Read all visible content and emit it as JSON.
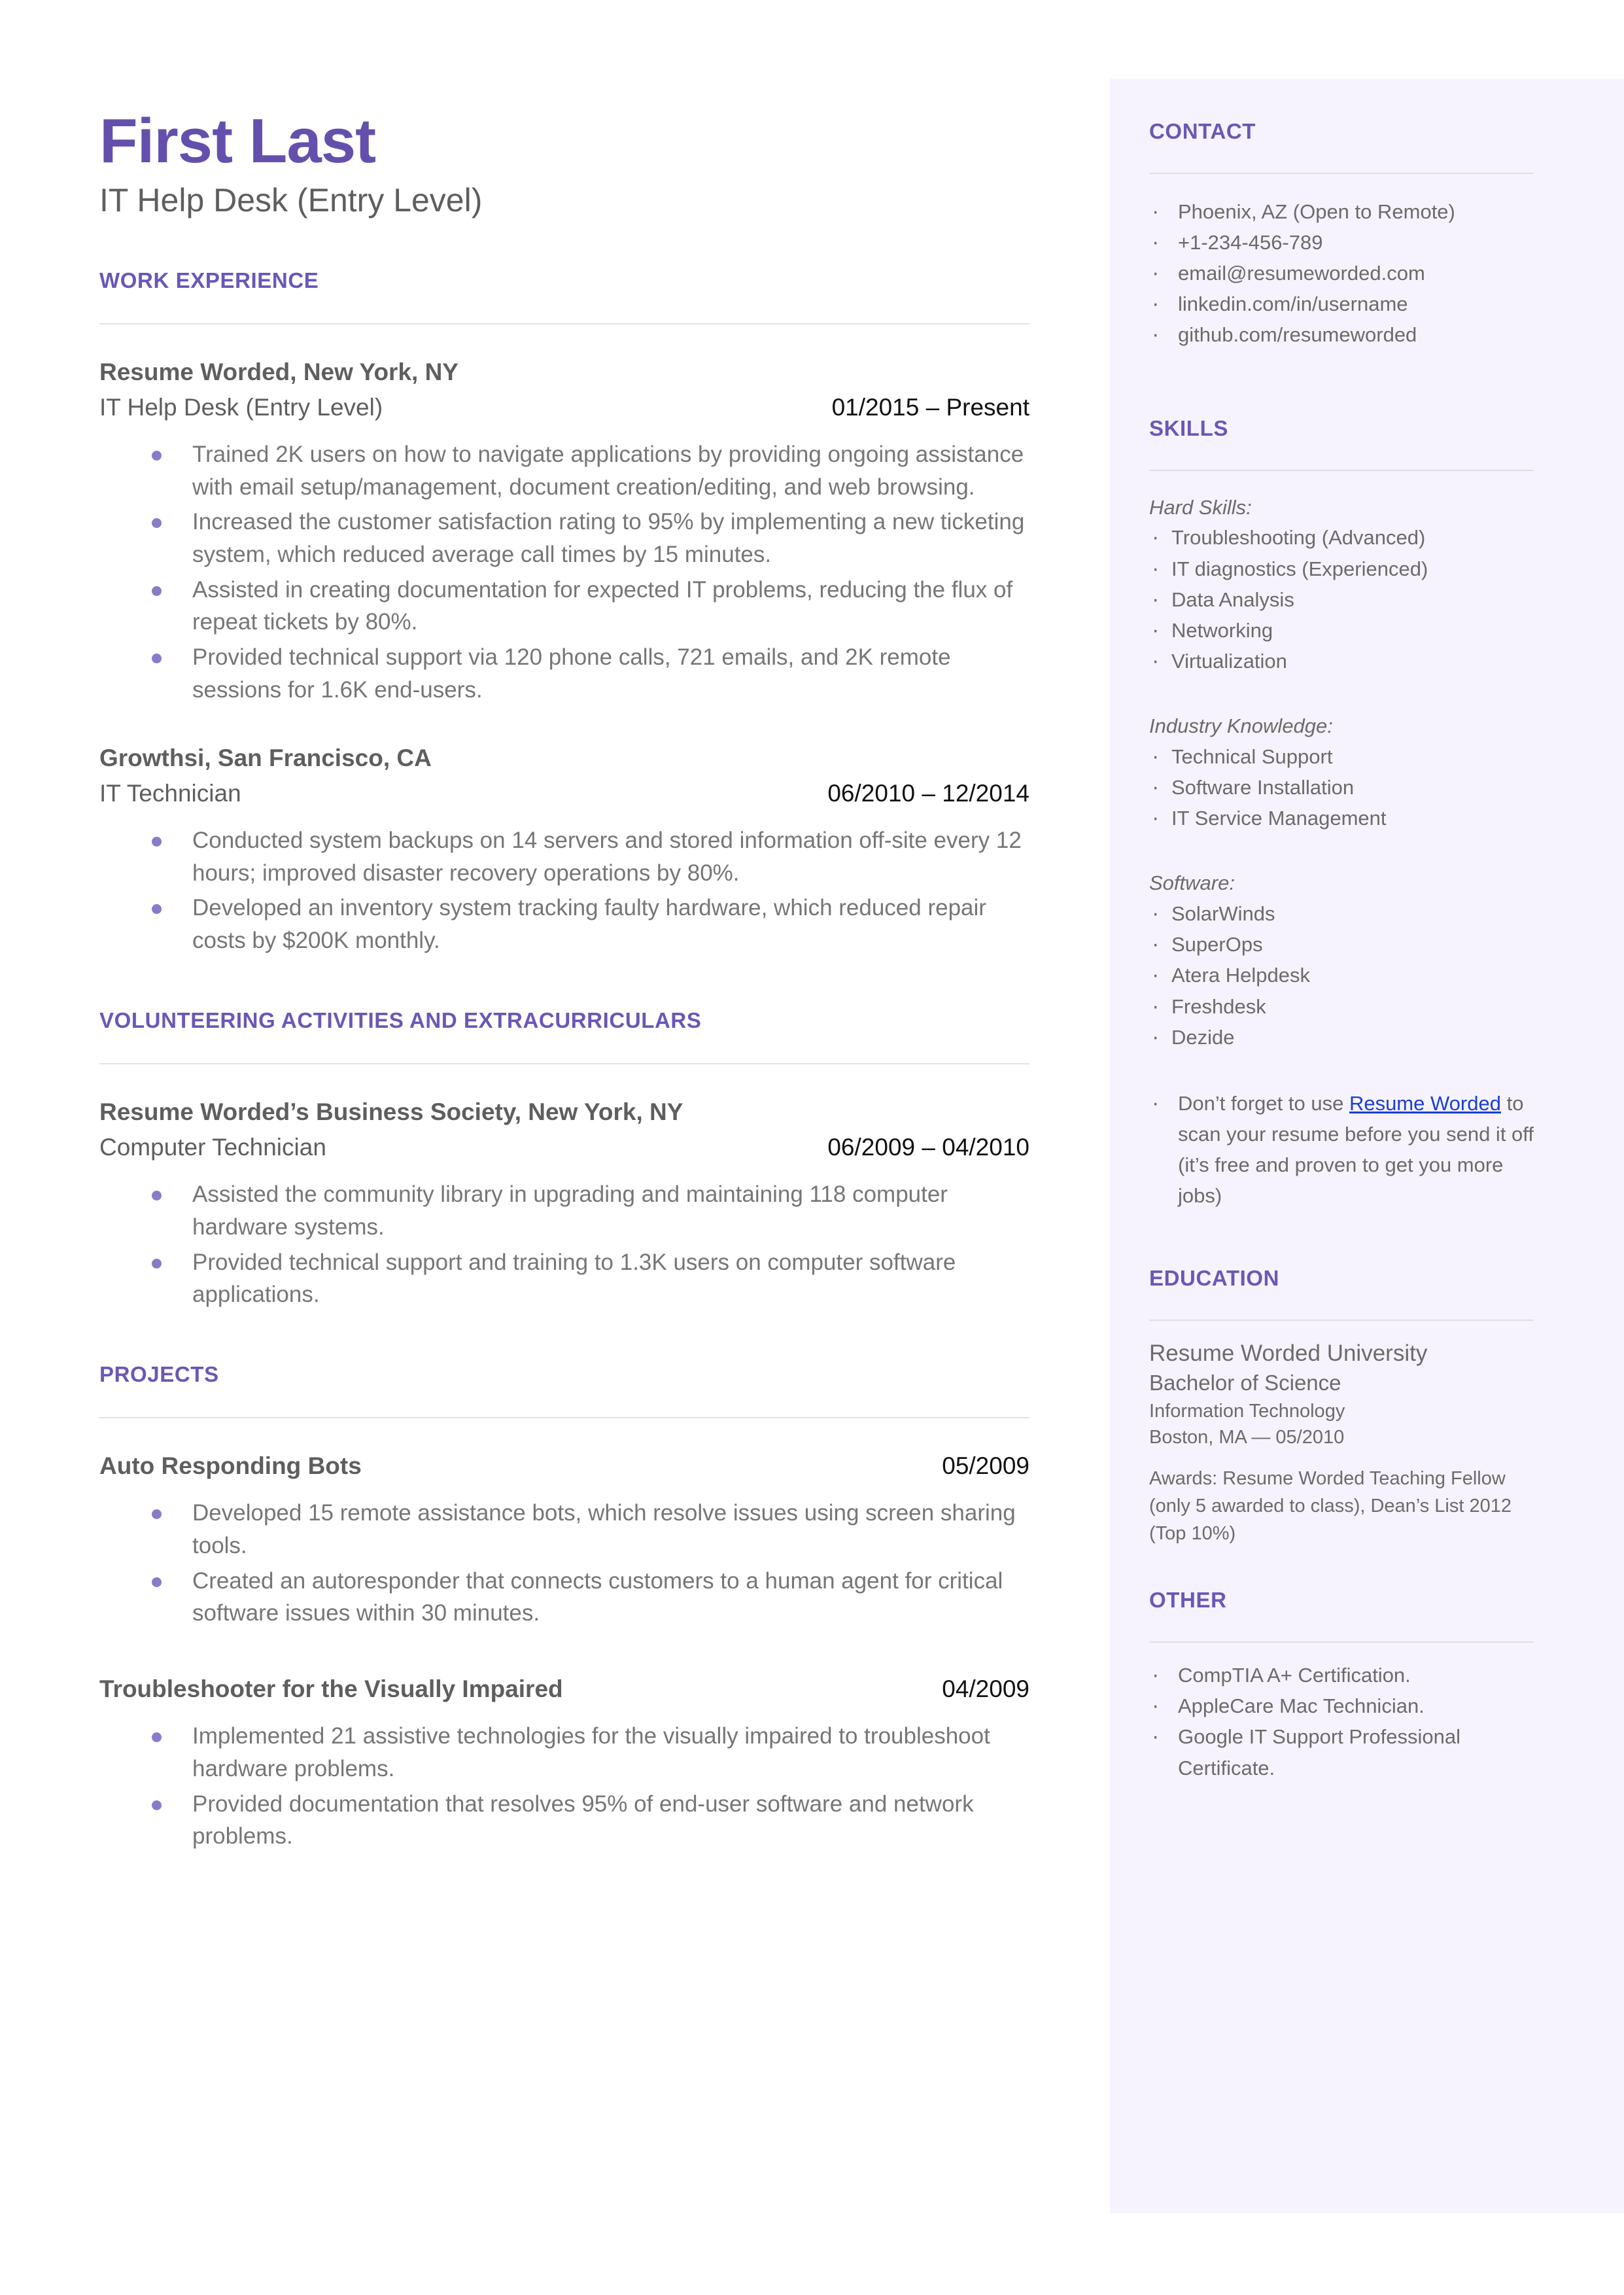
{
  "theme": {
    "accent_purple": "#6450ac",
    "heading_purple": "#6b57b5",
    "bullet_purple": "#8b7bc7",
    "sidebar_bg": "#f6f3fe",
    "body_gray": "#767676",
    "link_blue": "#1a3fd4"
  },
  "header": {
    "name": "First Last",
    "headline": "IT Help Desk (Entry Level)"
  },
  "main": {
    "sections": {
      "work": {
        "title": "WORK EXPERIENCE",
        "entries": [
          {
            "org": "Resume Worded, New York, NY",
            "role": "IT Help Desk (Entry Level)",
            "date": "01/2015 – Present",
            "bullets": [
              "Trained 2K users on how to navigate applications by providing ongoing assistance with email setup/management, document creation/editing, and web browsing.",
              "Increased the customer satisfaction rating to 95% by implementing a new ticketing system, which reduced average call times by 15 minutes.",
              "Assisted in creating documentation for expected IT problems, reducing the flux of repeat tickets by 80%.",
              "Provided technical support via 120 phone calls, 721 emails, and 2K remote sessions for 1.6K end-users."
            ]
          },
          {
            "org": "Growthsi, San Francisco, CA",
            "role": "IT Technician",
            "date": "06/2010 – 12/2014",
            "bullets": [
              "Conducted system backups on 14 servers and stored information off-site every 12 hours; improved disaster recovery operations by 80%.",
              "Developed an inventory system tracking faulty hardware, which reduced repair costs by $200K monthly."
            ]
          }
        ]
      },
      "volunteering": {
        "title": "VOLUNTEERING ACTIVITIES AND EXTRACURRICULARS",
        "entries": [
          {
            "org": "Resume Worded’s Business Society, New York, NY",
            "role": "Computer Technician",
            "date": "06/2009 – 04/2010",
            "bullets": [
              "Assisted the community library in upgrading and maintaining 118 computer hardware systems.",
              "Provided technical support and training to 1.3K users on computer software applications."
            ]
          }
        ]
      },
      "projects": {
        "title": "PROJECTS",
        "entries": [
          {
            "name": "Auto Responding Bots",
            "date": "05/2009",
            "bullets": [
              "Developed 15 remote assistance bots, which resolve issues using screen sharing tools.",
              "Created an autoresponder that connects customers to a human agent for critical software issues within 30 minutes."
            ]
          },
          {
            "name": "Troubleshooter for the Visually Impaired",
            "date": "04/2009",
            "bullets": [
              "Implemented 21 assistive technologies for the visually impaired to troubleshoot hardware problems.",
              "Provided documentation that resolves 95% of end-user software and network problems."
            ]
          }
        ]
      }
    }
  },
  "sidebar": {
    "contact": {
      "title": "CONTACT",
      "items": [
        "Phoenix, AZ (Open to Remote)",
        "+1-234-456-789",
        "email@resumeworded.com",
        "linkedin.com/in/username",
        "github.com/resumeworded"
      ]
    },
    "skills": {
      "title": "SKILLS",
      "groups": [
        {
          "label": "Hard Skills:",
          "items": [
            "Troubleshooting (Advanced)",
            "IT diagnostics (Experienced)",
            "Data Analysis",
            "Networking",
            "Virtualization"
          ]
        },
        {
          "label": "Industry Knowledge:",
          "items": [
            "Technical Support",
            "Software Installation",
            "IT Service Management"
          ]
        },
        {
          "label": "Software:",
          "items": [
            "SolarWinds",
            "SuperOps",
            "Atera Helpdesk",
            "Freshdesk",
            "Dezide"
          ]
        }
      ],
      "promo": {
        "before_link": "Don’t forget to use ",
        "link_text": "Resume Worded",
        "after_link": " to scan your resume before you send it off (it’s free and proven to get you more jobs)"
      }
    },
    "education": {
      "title": "EDUCATION",
      "school": "Resume Worded University",
      "degree": "Bachelor of Science",
      "field": "Information Technology",
      "location_date": "Boston, MA — 05/2010",
      "awards": "Awards: Resume Worded Teaching Fellow (only 5 awarded to class), Dean’s List 2012 (Top 10%)"
    },
    "other": {
      "title": "OTHER",
      "items": [
        "CompTIA A+ Certification.",
        "AppleCare Mac Technician.",
        "Google IT Support Professional Certificate."
      ]
    }
  }
}
